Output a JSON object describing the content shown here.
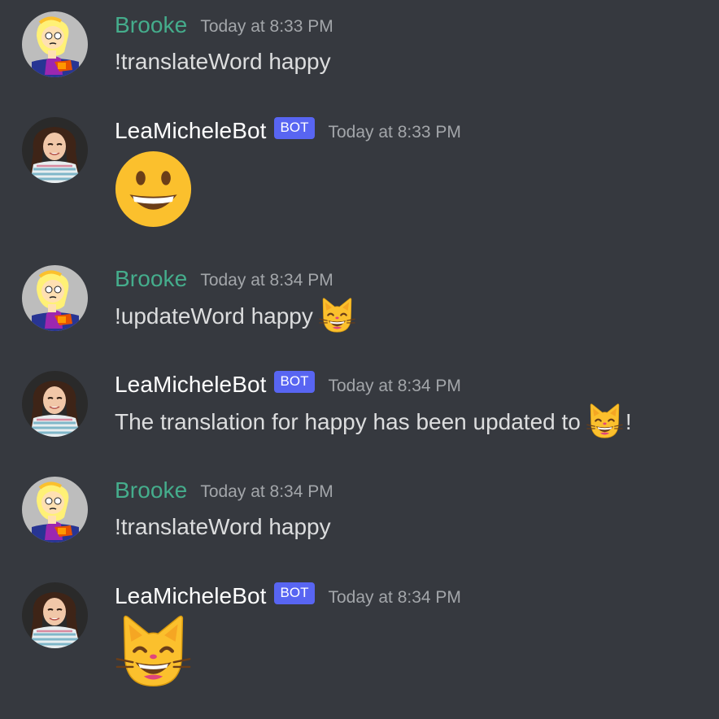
{
  "messages": [
    {
      "author": "Brooke",
      "timestamp": "Today at 8:33 PM",
      "text": "!translateWord happy"
    },
    {
      "author": "LeaMicheleBot",
      "bot_tag": "BOT",
      "timestamp": "Today at 8:33 PM",
      "emoji": "grinning-face"
    },
    {
      "author": "Brooke",
      "timestamp": "Today at 8:34 PM",
      "text": "!updateWord happy",
      "emoji": "grinning-cat-with-smiling-eyes"
    },
    {
      "author": "LeaMicheleBot",
      "bot_tag": "BOT",
      "timestamp": "Today at 8:34 PM",
      "text": "The translation for happy has been updated to",
      "emoji": "grinning-cat-with-smiling-eyes",
      "text_after": "!"
    },
    {
      "author": "Brooke",
      "timestamp": "Today at 8:34 PM",
      "text": "!translateWord happy"
    },
    {
      "author": "LeaMicheleBot",
      "bot_tag": "BOT",
      "timestamp": "Today at 8:34 PM",
      "emoji": "grinning-cat-with-smiling-eyes"
    }
  ],
  "colors": {
    "background": "#36393f",
    "user_name": "#45ad8c",
    "bot_name": "#ffffff",
    "bot_tag": "#5865f2",
    "timestamp": "#a3a6aa",
    "text": "#dcddde"
  }
}
